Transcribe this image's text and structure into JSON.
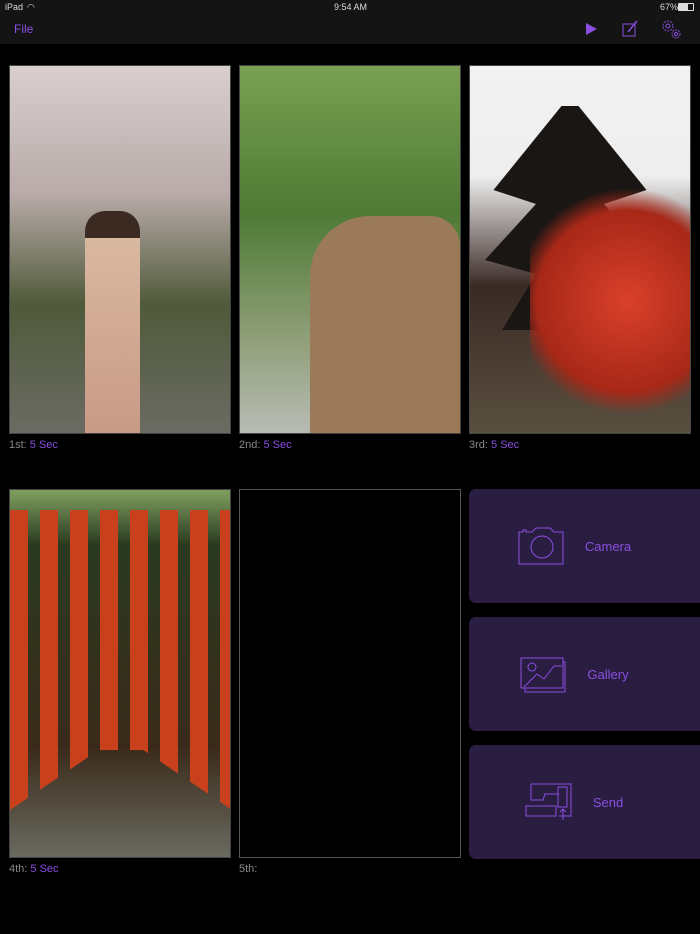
{
  "status_bar": {
    "device": "iPad",
    "time": "9:54 AM",
    "battery": "67%"
  },
  "nav": {
    "file_label": "File"
  },
  "slots": [
    {
      "label": "1st:",
      "duration": "5 Sec"
    },
    {
      "label": "2nd:",
      "duration": "5 Sec"
    },
    {
      "label": "3rd:",
      "duration": "5 Sec"
    },
    {
      "label": "4th:",
      "duration": "5 Sec"
    },
    {
      "label": "5th:",
      "duration": ""
    }
  ],
  "actions": {
    "camera": "Camera",
    "gallery": "Gallery",
    "send": "Send"
  },
  "colors": {
    "accent": "#8a4fe0",
    "button_bg": "#2a1d42"
  }
}
